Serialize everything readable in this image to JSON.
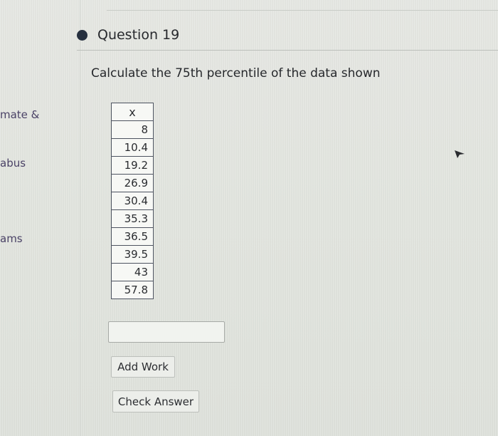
{
  "sidebar": {
    "items": [
      {
        "label": "mate &"
      },
      {
        "label": "abus"
      },
      {
        "label": "ams"
      }
    ]
  },
  "question": {
    "title": "Question 19",
    "prompt": "Calculate the 75th percentile of the data shown"
  },
  "table": {
    "header": "x",
    "values": [
      "8",
      "10.4",
      "19.2",
      "26.9",
      "30.4",
      "35.3",
      "36.5",
      "39.5",
      "43",
      "57.8"
    ]
  },
  "answer": {
    "value": "",
    "placeholder": ""
  },
  "buttons": {
    "add_work": "Add Work",
    "check_answer": "Check Answer"
  },
  "colors": {
    "bullet": "#26303f",
    "sidebar_text": "#4a4266",
    "table_border": "#4d5360"
  },
  "icons": {
    "bullet": "filled-circle",
    "cursor": "mouse-pointer-arrow"
  }
}
